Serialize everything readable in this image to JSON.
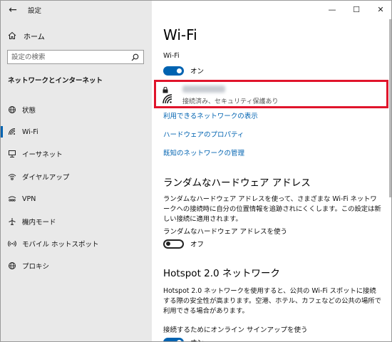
{
  "window": {
    "app_title": "設定",
    "controls": {
      "minimize": "—",
      "maximize": "☐",
      "close": "✕"
    }
  },
  "sidebar": {
    "back_icon": "back-arrow-icon",
    "home_label": "ホーム",
    "search_placeholder": "設定の検索",
    "section_title": "ネットワークとインターネット",
    "items": [
      {
        "label": "状態",
        "icon": "globe-status-icon",
        "active": false
      },
      {
        "label": "Wi-Fi",
        "icon": "wifi-icon",
        "active": true
      },
      {
        "label": "イーサネット",
        "icon": "ethernet-icon",
        "active": false
      },
      {
        "label": "ダイヤルアップ",
        "icon": "dialup-icon",
        "active": false
      },
      {
        "label": "VPN",
        "icon": "vpn-icon",
        "active": false
      },
      {
        "label": "機内モード",
        "icon": "airplane-icon",
        "active": false
      },
      {
        "label": "モバイル ホットスポット",
        "icon": "hotspot-icon",
        "active": false
      },
      {
        "label": "プロキシ",
        "icon": "globe-icon",
        "active": false
      }
    ],
    "active_color": "#0063b1"
  },
  "main": {
    "title": "Wi-Fi",
    "wifi_label": "Wi-Fi",
    "wifi_toggle": {
      "state": "on",
      "text": "オン"
    },
    "network": {
      "name": "",
      "status": "接続済み、セキュリティ保護あり",
      "highlight_color": "#e0142b"
    },
    "links": [
      "利用できるネットワークの表示",
      "ハードウェアのプロパティ",
      "既知のネットワークの管理"
    ],
    "random_hw": {
      "heading": "ランダムなハードウェア アドレス",
      "description": "ランダムなハードウェア アドレスを使って、さまざまな Wi-Fi ネットワークへの接続時に自分の位置情報を追跡されにくくします。この設定は新しい接続に適用されます。",
      "toggle_label": "ランダムなハードウェア アドレスを使う",
      "toggle": {
        "state": "off",
        "text": "オフ"
      }
    },
    "hotspot": {
      "heading": "Hotspot 2.0 ネットワーク",
      "description": "Hotspot 2.0 ネットワークを使用すると、公共の Wi-Fi スポットに接続する際の安全性が高まります。空港、ホテル、カフェなどの公共の場所で利用できる場合があります。",
      "toggle_label": "接続するためにオンライン サインアップを使う",
      "toggle": {
        "state": "on",
        "text": "オン"
      }
    },
    "accent_color": "#0063b1"
  }
}
